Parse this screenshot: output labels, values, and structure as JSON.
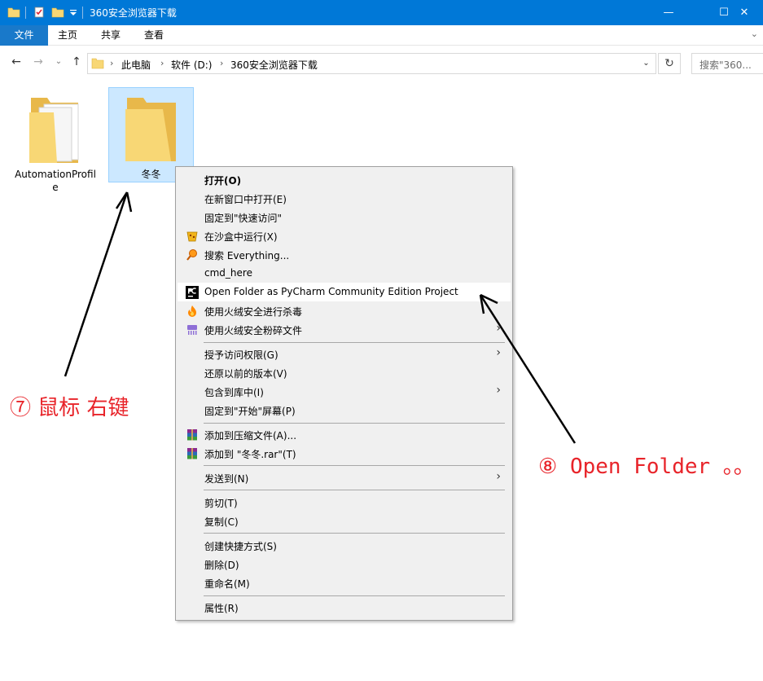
{
  "window": {
    "title": "360安全浏览器下载",
    "minimize_label": "—",
    "maximize_label": "☐",
    "close_label": "✕"
  },
  "ribbon": {
    "tabs": [
      "文件",
      "主页",
      "共享",
      "查看"
    ],
    "expand_label": "⌄"
  },
  "nav": {
    "back_label": "←",
    "forward_label": "→",
    "recent_label": "⌄",
    "up_label": "↑",
    "breadcrumbs": [
      "此电脑",
      "软件 (D:)",
      "360安全浏览器下载"
    ],
    "separator": "›",
    "dropdown_label": "⌄",
    "refresh_label": "↻",
    "search_placeholder": "搜索\"360..."
  },
  "items": [
    {
      "name": "AutomationProfile"
    },
    {
      "name": "冬冬"
    }
  ],
  "context_menu": {
    "items": [
      {
        "label": "打开(O)",
        "bold": true
      },
      {
        "label": "在新窗口中打开(E)"
      },
      {
        "label": "固定到\"快速访问\""
      },
      {
        "label": "在沙盒中运行(X)",
        "icon": "sandbox-icon"
      },
      {
        "label": "搜索 Everything...",
        "icon": "everything-search-icon"
      },
      {
        "label": "cmd_here"
      },
      {
        "label": "Open Folder as PyCharm Community Edition Project",
        "icon": "pycharm-icon"
      },
      {
        "label": "使用火绒安全进行杀毒",
        "icon": "huorong-antivirus-icon"
      },
      {
        "label": "使用火绒安全粉碎文件",
        "icon": "huorong-shred-icon"
      },
      {
        "label": "授予访问权限(G)",
        "submenu": true
      },
      {
        "label": "还原以前的版本(V)"
      },
      {
        "label": "包含到库中(I)",
        "submenu": true
      },
      {
        "label": "固定到\"开始\"屏幕(P)"
      },
      {
        "label": "添加到压缩文件(A)...",
        "icon": "winrar-icon"
      },
      {
        "label": "添加到 \"冬冬.rar\"(T)",
        "icon": "winrar-icon"
      },
      {
        "label": "发送到(N)",
        "submenu": true
      },
      {
        "label": "剪切(T)"
      },
      {
        "label": "复制(C)"
      },
      {
        "label": "创建快捷方式(S)"
      },
      {
        "label": "删除(D)"
      },
      {
        "label": "重命名(M)"
      },
      {
        "label": "属性(R)"
      }
    ],
    "submenu_arrow": "›"
  },
  "annotations": {
    "step7": "⑦ 鼠标 右键",
    "step8": "⑧ Open Folder 。。"
  },
  "colors": {
    "titlebar": "#0078d7",
    "selection": "#cce8ff",
    "annotation": "#e8242a"
  }
}
